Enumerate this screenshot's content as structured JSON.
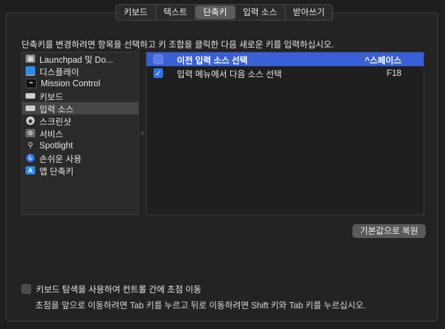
{
  "tabs": [
    {
      "label": "키보드",
      "selected": false
    },
    {
      "label": "텍스트",
      "selected": false
    },
    {
      "label": "단축키",
      "selected": true
    },
    {
      "label": "입력 소스",
      "selected": false
    },
    {
      "label": "받아쓰기",
      "selected": false
    }
  ],
  "instruction": "단축키를 변경하려면 항목을 선택하고 키 조합을 클릭한 다음 새로운 키를 입력하십시오.",
  "sidebar": {
    "items": [
      {
        "label": "Launchpad 및 Do...",
        "icon": "launchpad-icon",
        "color": "#8a8a8a"
      },
      {
        "label": "디스플레이",
        "icon": "display-icon",
        "color": "#2a8cf0"
      },
      {
        "label": "Mission Control",
        "icon": "mission-control-icon",
        "color": "#1a1a1a"
      },
      {
        "label": "키보드",
        "icon": "keyboard-icon",
        "color": "#cfcfcf"
      },
      {
        "label": "입력 소스",
        "icon": "input-source-icon",
        "color": "#cfcfcf",
        "selected": true
      },
      {
        "label": "스크린샷",
        "icon": "screenshot-icon",
        "color": "#e0e0e0"
      },
      {
        "label": "서비스",
        "icon": "services-icon",
        "color": "#cfcfcf"
      },
      {
        "label": "Spotlight",
        "icon": "spotlight-icon",
        "color": "#cfcfcf"
      },
      {
        "label": "손쉬운 사용",
        "icon": "accessibility-icon",
        "color": "#2a7cf0"
      },
      {
        "label": "앱 단축키",
        "icon": "app-shortcuts-icon",
        "color": "#2a8cf0"
      }
    ]
  },
  "shortcuts": [
    {
      "label": "이전 입력 소스 선택",
      "key": "^스페이스",
      "checked": false,
      "selected": true
    },
    {
      "label": "입력 메뉴에서 다음 소스 선택",
      "key": "F18",
      "checked": true,
      "selected": false
    }
  ],
  "restore_button": "기본값으로 복원",
  "keyboard_navigation": {
    "label": "키보드 탐색을 사용하여 컨트롤 간에 초점 이동",
    "checked": false,
    "description": "초점을 앞으로 이동하려면 Tab 키를 누르고 뒤로 이동하려면 Shift 키와 Tab 키를 누르십시오."
  },
  "colors": {
    "accent": "#3a60d8",
    "checkbox_on": "#2f74f0",
    "background": "#1e1e1e"
  }
}
